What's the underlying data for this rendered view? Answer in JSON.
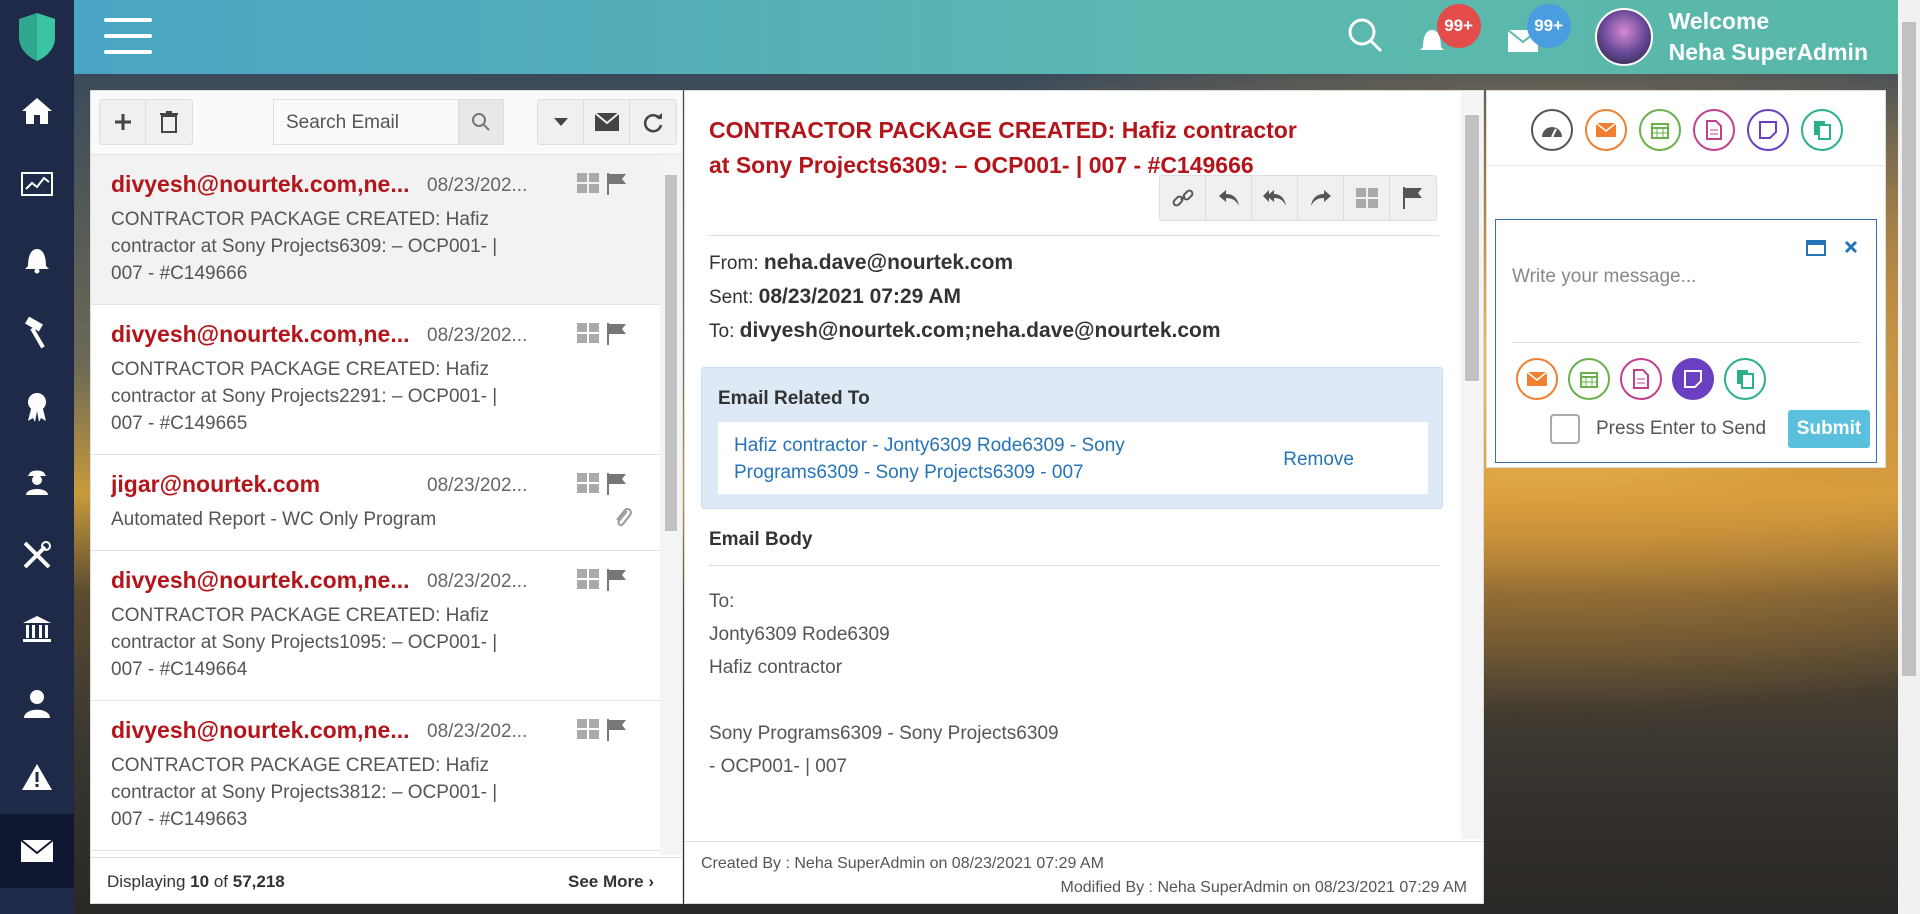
{
  "header": {
    "notifications_badge": "99+",
    "messages_badge": "99+",
    "welcome_line1": "Welcome",
    "welcome_line2": "Neha SuperAdmin"
  },
  "sidebar": {
    "items": [
      "home-icon",
      "dashboard-icon",
      "bell-icon",
      "hammer-icon",
      "badge-icon",
      "worker-icon",
      "tools-icon",
      "bank-icon",
      "user-icon",
      "warning-icon",
      "mail-icon"
    ]
  },
  "list": {
    "search_placeholder": "Search Email",
    "items": [
      {
        "from": "divyesh@nourtek.com,ne...",
        "date": "08/23/202...",
        "subject": "CONTRACTOR PACKAGE CREATED: Hafiz contractor at Sony Projects6309: – OCP001- | 007 - #C149666"
      },
      {
        "from": "divyesh@nourtek.com,ne...",
        "date": "08/23/202...",
        "subject": "CONTRACTOR PACKAGE CREATED: Hafiz contractor at Sony Projects2291: – OCP001- | 007 - #C149665"
      },
      {
        "from": "jigar@nourtek.com",
        "date": "08/23/202...",
        "subject": "Automated Report - WC Only Program"
      },
      {
        "from": "divyesh@nourtek.com,ne...",
        "date": "08/23/202...",
        "subject": "CONTRACTOR PACKAGE CREATED: Hafiz contractor at Sony Projects1095: – OCP001- | 007 - #C149664"
      },
      {
        "from": "divyesh@nourtek.com,ne...",
        "date": "08/23/202...",
        "subject": "CONTRACTOR PACKAGE CREATED: Hafiz contractor at Sony Projects3812: – OCP001- | 007 - #C149663"
      }
    ],
    "footer_prefix": "Displaying",
    "footer_count": "10",
    "footer_of": "of",
    "footer_total": "57,218",
    "see_more": "See More"
  },
  "detail": {
    "subject_line1": "CONTRACTOR PACKAGE CREATED: Hafiz contractor",
    "subject_line2": "at Sony Projects6309: – OCP001- | 007 - #C149666",
    "from_label": "From:",
    "from_value": "neha.dave@nourtek.com",
    "sent_label": "Sent:",
    "sent_value": "08/23/2021 07:29 AM",
    "to_label": "To:",
    "to_value": "divyesh@nourtek.com;neha.dave@nourtek.com",
    "related_title": "Email Related To",
    "related_link_line1": "Hafiz contractor - Jonty6309 Rode6309 - Sony",
    "related_link_line2": "Programs6309 - Sony Projects6309 - 007",
    "remove": "Remove",
    "body_title": "Email Body",
    "body_lines": [
      "To:",
      "Jonty6309 Rode6309",
      "Hafiz contractor",
      "",
      "Sony Programs6309 - Sony Projects6309",
      "- OCP001- | 007"
    ],
    "created_by": "Created By : Neha SuperAdmin on 08/23/2021 07:29 AM",
    "modified_by": "Modified By : Neha SuperAdmin on 08/23/2021 07:29 AM"
  },
  "chat": {
    "placeholder": "Write your message...",
    "press_enter": "Press Enter to Send",
    "submit": "Submit"
  }
}
